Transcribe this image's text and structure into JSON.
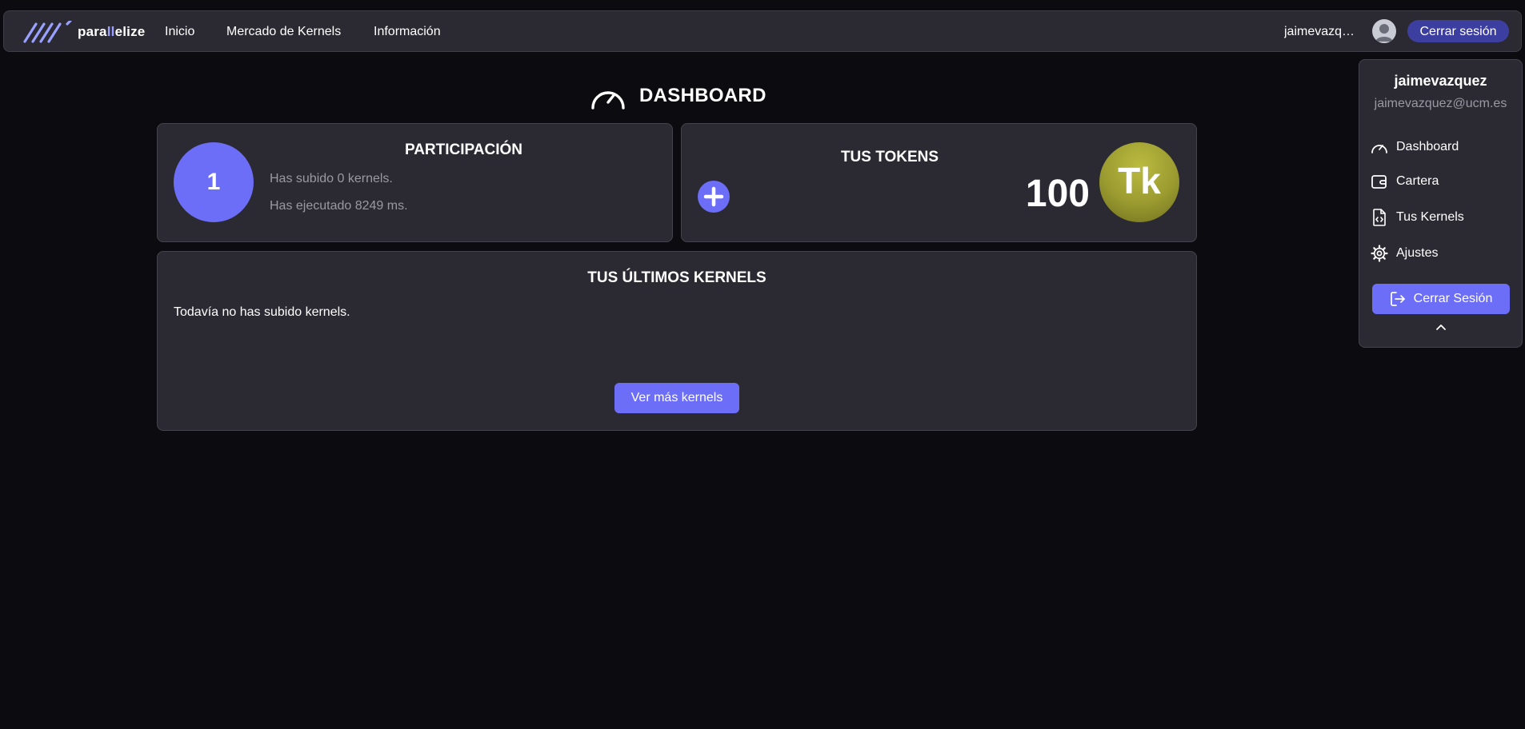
{
  "navbar": {
    "logo_text_start": "para",
    "logo_text_accent": "ll",
    "logo_text_end": "elize",
    "links": [
      {
        "label": "Inicio"
      },
      {
        "label": "Mercado de Kernels"
      },
      {
        "label": "Información"
      }
    ],
    "username": "jaimevazquez",
    "logout_label": "Cerrar sesión"
  },
  "page": {
    "title": "DASHBOARD",
    "title_icon": "speedometer-icon"
  },
  "participation": {
    "heading": "PARTICIPACIÓN",
    "count": "1",
    "uploaded_text": "Has subido 0 kernels.",
    "executed_text": "Has ejecutado 8249 ms."
  },
  "tokens": {
    "heading": "TUS TOKENS",
    "value": "100",
    "coin_label": "Tk",
    "add_icon": "plus-icon"
  },
  "kernels": {
    "heading": "TUS ÚLTIMOS KERNELS",
    "empty_message": "Todavía no has subido kernels.",
    "more_label": "Ver más kernels"
  },
  "dropdown": {
    "username": "jaimevazquez",
    "email": "jaimevazquez@ucm.es",
    "items": [
      {
        "label": "Dashboard",
        "icon": "speedometer-icon"
      },
      {
        "label": "Cartera",
        "icon": "wallet-icon"
      },
      {
        "label": "Tus Kernels",
        "icon": "code-file-icon"
      },
      {
        "label": "Ajustes",
        "icon": "gear-icon"
      }
    ],
    "logout_label": "Cerrar Sesión",
    "collapse_icon": "chevron-up-icon"
  },
  "colors": {
    "background": "#0c0c10",
    "panel": "#2b2a33",
    "accent": "#6d6ef7",
    "nav_logout": "#3d3fa0",
    "muted_text": "#9a99a3",
    "coin": "#9a9a30"
  }
}
